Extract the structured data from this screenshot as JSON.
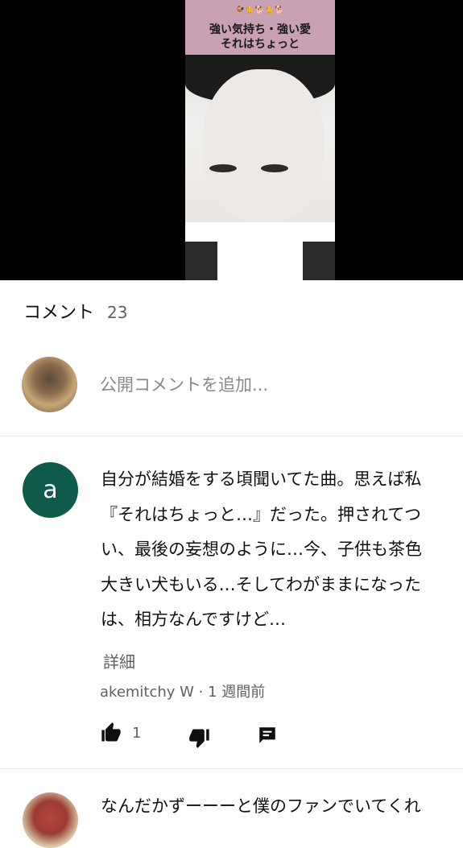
{
  "video": {
    "cover_animals": "🐓🐈🐕🐈🐕",
    "cover_title_line1": "強い気持ち・強い愛",
    "cover_title_line2": "それはちょっと"
  },
  "comments": {
    "title": "コメント",
    "count": "23",
    "add_placeholder": "公開コメントを追加..."
  },
  "comment1": {
    "avatar_letter": "a",
    "lines": [
      "自分が結婚をする頃聞いてた曲。思えば私",
      "『それはちょっと…』だった。押されてつ",
      "い、最後の妄想のように…今、子供も茶色",
      "大きい犬もいる…そしてわがままになった",
      "は、相方なんですけど…"
    ],
    "read_more": "詳細",
    "meta": "akemitchy W · 1 週間前",
    "likes": "1"
  },
  "comment2": {
    "text": "なんだかずーーーと僕のファンでいてくれ"
  },
  "colors": {
    "avatar_a": "#0e5a4b",
    "secondary_text": "#606060"
  }
}
